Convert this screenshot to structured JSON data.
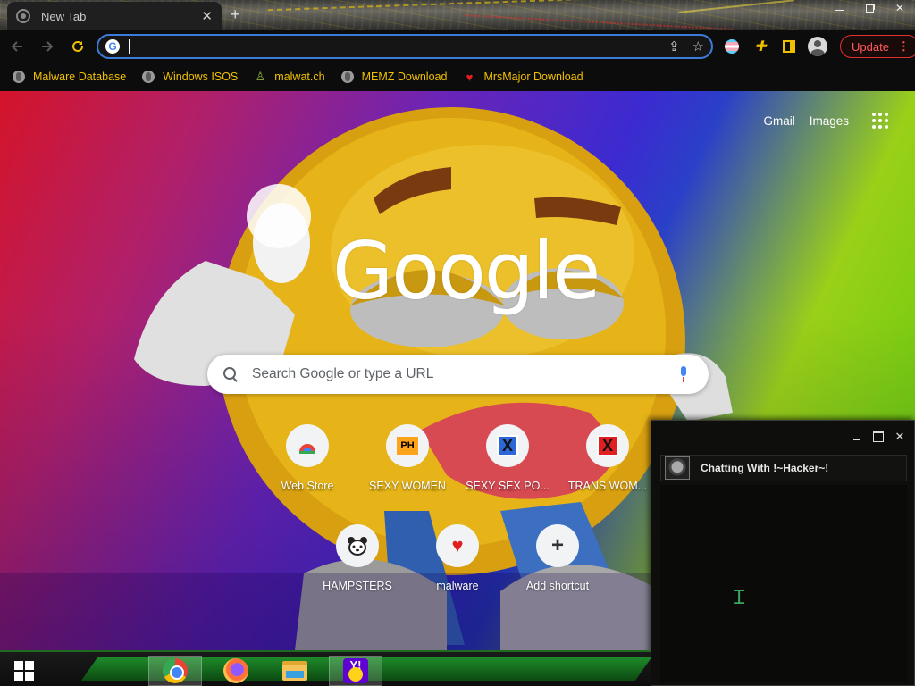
{
  "tab": {
    "title": "New Tab",
    "close": "✕",
    "new_tab": "+"
  },
  "window_controls": {
    "close": "✕"
  },
  "omnibox": {
    "value": "",
    "placeholder": ""
  },
  "toolbar": {
    "update_label": "Update",
    "update_menu": "⋮"
  },
  "bookmarks": [
    {
      "label": "Malware Database",
      "icon": "globe-icon"
    },
    {
      "label": "Windows ISOS",
      "icon": "globe-icon"
    },
    {
      "label": "malwat.ch",
      "icon": "alien-icon"
    },
    {
      "label": "MEMZ Download",
      "icon": "globe-icon"
    },
    {
      "label": "MrsMajor Download",
      "icon": "heart-icon"
    }
  ],
  "ntp": {
    "links": {
      "gmail": "Gmail",
      "images": "Images"
    },
    "logo": "Google",
    "search_placeholder": "Search Google or type a URL",
    "shortcuts": [
      {
        "label": "Web Store",
        "icon": "webstore-icon"
      },
      {
        "label": "SEXY WOMEN",
        "icon": "ph-icon",
        "badge": "PH"
      },
      {
        "label": "SEXY SEX PO...",
        "icon": "x-blue-icon",
        "badge": "X"
      },
      {
        "label": "TRANS WOM...",
        "icon": "x-red-icon",
        "badge": "X"
      },
      {
        "label": "HAMPSTERS",
        "icon": "hamster-icon"
      },
      {
        "label": "malware",
        "icon": "heart-icon"
      },
      {
        "label": "Add shortcut",
        "icon": "plus-icon"
      }
    ]
  },
  "chat": {
    "title": "Chatting With !~Hacker~!",
    "close": "✕"
  },
  "colors": {
    "accent_yellow": "#f0c000",
    "omnibox_border": "#3d7bd9",
    "update_red": "#ff5b5b",
    "taskbar_green": "#1e8a2a"
  },
  "taskbar": {
    "apps": [
      "chrome-icon",
      "firefox-icon",
      "file-explorer-icon",
      "yahoo-messenger-icon"
    ]
  }
}
